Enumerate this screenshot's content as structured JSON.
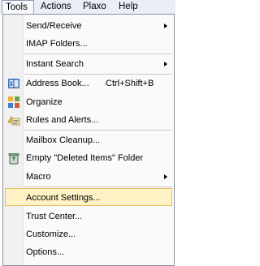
{
  "menubar": {
    "tools": "Tools",
    "actions": "Actions",
    "plaxo": "Plaxo",
    "help": "Help"
  },
  "menu": {
    "send_receive": "Send/Receive",
    "imap_folders": "IMAP Folders...",
    "instant_search": "Instant Search",
    "address_book": "Address Book...",
    "address_book_shortcut": "Ctrl+Shift+B",
    "organize": "Organize",
    "rules_alerts": "Rules and Alerts...",
    "mailbox_cleanup": "Mailbox Cleanup...",
    "empty_deleted": "Empty \"Deleted Items\" Folder",
    "macro": "Macro",
    "account_settings": "Account Settings...",
    "trust_center": "Trust Center...",
    "customize": "Customize...",
    "options": "Options..."
  },
  "icons": {
    "address_book": "address-book-icon",
    "organize": "organize-icon",
    "rules_alerts": "rules-alerts-icon",
    "empty_deleted": "recycle-bin-icon"
  },
  "colors": {
    "menubar_bg": "#e9eef7",
    "highlight_bg": "#fff3c6",
    "highlight_border": "#e3bf5a"
  }
}
